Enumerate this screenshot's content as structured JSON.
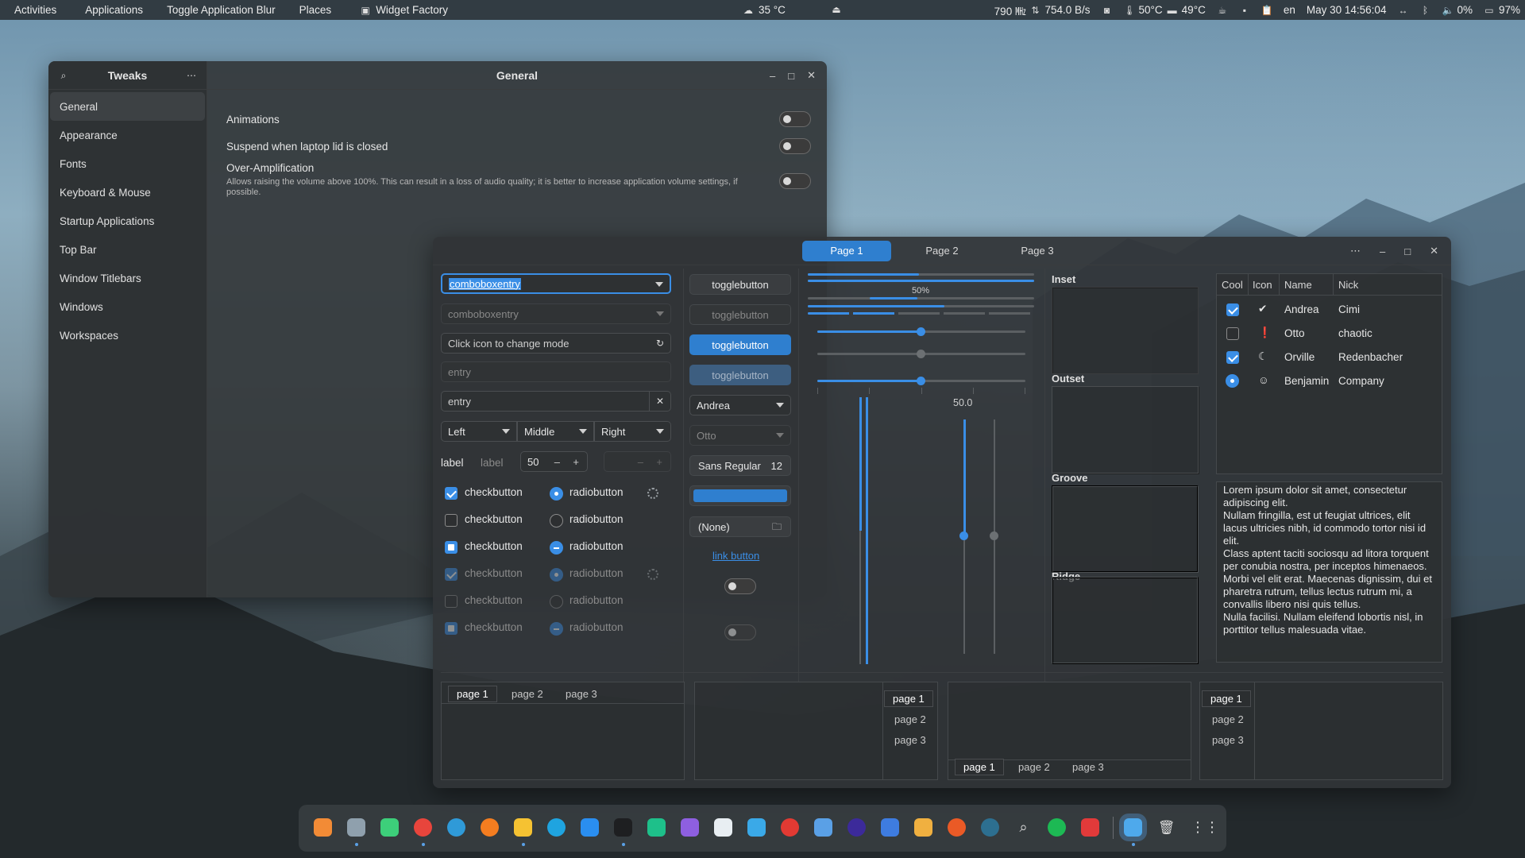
{
  "topbar": {
    "activities": "Activities",
    "applications": "Applications",
    "toggle_blur": "Toggle Application Blur",
    "places": "Places",
    "widget_factory": "Widget Factory",
    "weather": "35 °C",
    "mem": "790 ㎒",
    "net": "754.0  B/s",
    "cpu_temp": "50°C",
    "gpu_temp": "49°C",
    "lang": "en",
    "datetime": "May 30  14:56:04",
    "volume": "0%",
    "battery": "97%"
  },
  "tweaks": {
    "title": "Tweaks",
    "page_title": "General",
    "nav": [
      "General",
      "Appearance",
      "Fonts",
      "Keyboard & Mouse",
      "Startup Applications",
      "Top Bar",
      "Window Titlebars",
      "Windows",
      "Workspaces"
    ],
    "animations": "Animations",
    "suspend": "Suspend when laptop lid is closed",
    "overamp": "Over-Amplification",
    "overamp_desc": "Allows raising the volume above 100%. This can result in a loss of audio quality; it is better to increase application volume settings, if possible."
  },
  "wf": {
    "tabs": [
      "Page 1",
      "Page 2",
      "Page 3"
    ],
    "combo1": "comboboxentry",
    "combo2": "comboboxentry",
    "mode_entry": "Click icon to change mode",
    "entry_placeholder": "entry",
    "entry_value": "entry",
    "align": [
      "Left",
      "Middle",
      "Right"
    ],
    "label1": "label",
    "label2": "label",
    "spin_value": "50",
    "check": "checkbutton",
    "radio": "radiobutton",
    "toggle": "togglebutton",
    "combo_andrea": "Andrea",
    "combo_otto": "Otto",
    "font_name": "Sans Regular",
    "font_size": "12",
    "file_none": "(None)",
    "link": "link button",
    "progress_label": "50%",
    "scale_value": "50.0",
    "frames": [
      "Inset",
      "Outset",
      "Groove",
      "Ridge"
    ],
    "tree": {
      "headers": [
        "Cool",
        "Icon",
        "Name",
        "Nick"
      ],
      "rows": [
        {
          "name": "Andrea",
          "nick": "Cimi"
        },
        {
          "name": "Otto",
          "nick": "chaotic"
        },
        {
          "name": "Orville",
          "nick": "Redenbacher"
        },
        {
          "name": "Benjamin",
          "nick": "Company"
        }
      ]
    },
    "lorem": [
      "Lorem ipsum dolor sit amet, consectetur adipiscing elit.",
      "Nullam fringilla, est ut feugiat ultrices, elit lacus ultricies nibh, id commodo tortor nisi id elit.",
      "Class aptent taciti sociosqu ad litora torquent per conubia nostra, per inceptos himenaeos.",
      "Morbi vel elit erat. Maecenas dignissim, dui et pharetra rutrum, tellus lectus rutrum mi, a convallis libero nisi quis tellus.",
      "Nulla facilisi. Nullam eleifend lobortis nisl, in porttitor tellus malesuada vitae."
    ],
    "nb_tabs": [
      "page 1",
      "page 2",
      "page 3"
    ]
  },
  "colors": {
    "accent": "#3a8ee6",
    "bg": "#303437"
  }
}
